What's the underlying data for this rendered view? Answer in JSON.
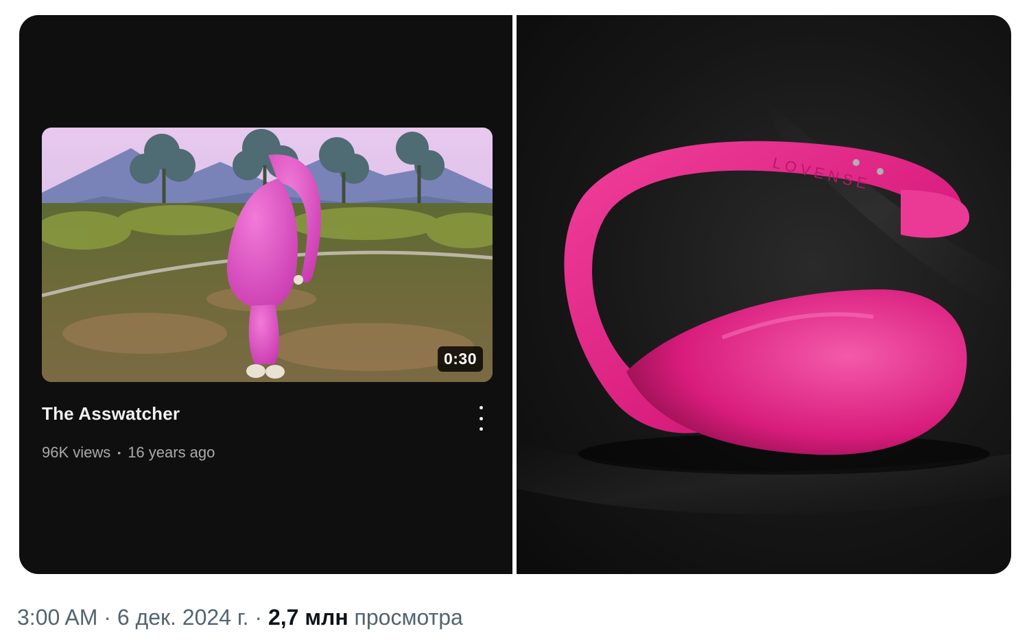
{
  "video_card": {
    "duration": "0:30",
    "title": "The Asswatcher",
    "views": "96K views",
    "separator": "•",
    "age": "16 years ago",
    "menu_icon": "more-vert-icon"
  },
  "product_photo": {
    "brand_text": "LOVENSE",
    "accent_color": "#e8348c"
  },
  "tweet_footer": {
    "time": "3:00 AM",
    "separator": "·",
    "date": "6 дек. 2024 г.",
    "views_count": "2,7 млн",
    "views_label": "просмотра"
  },
  "colors": {
    "dark_bg": "#0f0f0f",
    "meta_text": "#aaaaaa",
    "footer_text": "#536471"
  }
}
